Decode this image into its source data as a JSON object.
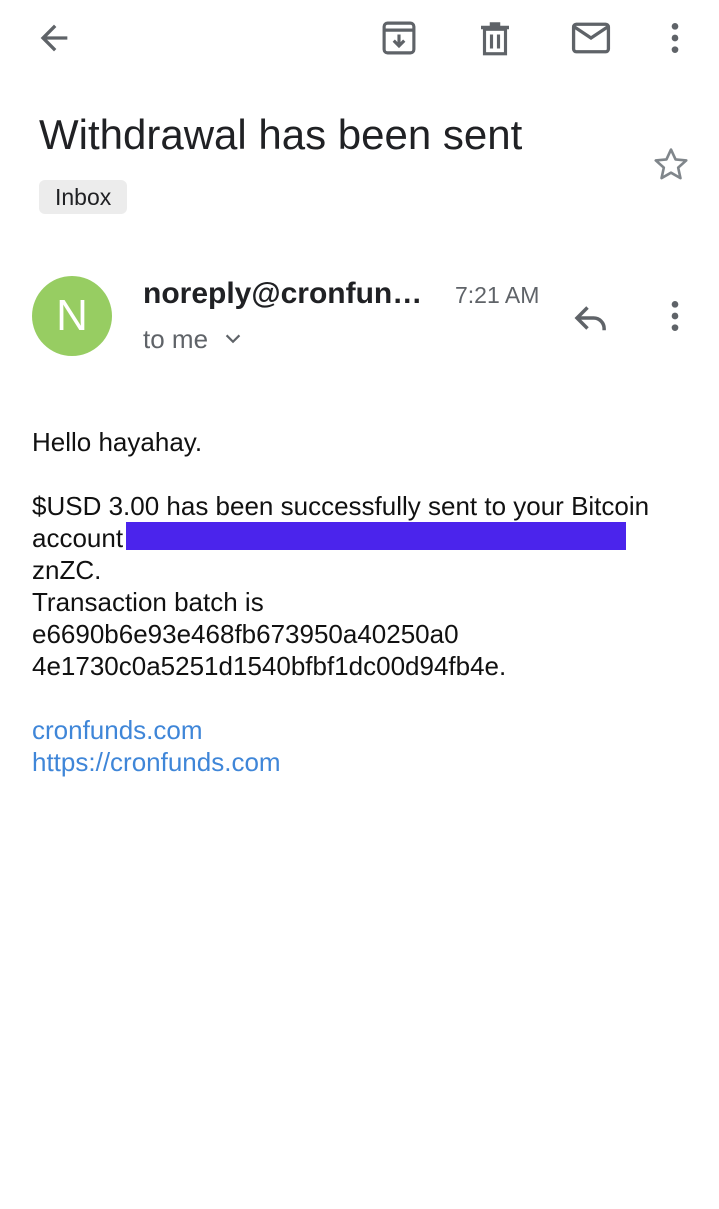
{
  "toolbar": {
    "back_icon": "arrow-back-icon",
    "archive_icon": "archive-icon",
    "delete_icon": "trash-icon",
    "mark_unread_icon": "mail-icon",
    "more_icon": "more-vert-icon"
  },
  "email": {
    "subject": "Withdrawal has been sent",
    "label": "Inbox",
    "starred": false,
    "sender": {
      "initial": "N",
      "address": "noreply@cronfun…",
      "avatar_color": "#97cd62"
    },
    "time": "7:21 AM",
    "recipient": "to me",
    "body": {
      "greeting": "Hello hayahay.",
      "line_sent": "$USD 3.00 has been successfully sent to your Bitcoin",
      "line_account": "account",
      "redaction_color": "#4b24ec",
      "line_account_tail": "znZC.",
      "line_batch_label": "Transaction batch is",
      "batch_line_1": "e6690b6e93e468fb673950a40250a0",
      "batch_line_2": "4e1730c0a5251d1540bfbf1dc00d94fb4e.",
      "links": [
        "cronfunds.com",
        "https://cronfunds.com"
      ]
    }
  },
  "colors": {
    "link": "#3f86d8",
    "icon": "#5f6368"
  }
}
